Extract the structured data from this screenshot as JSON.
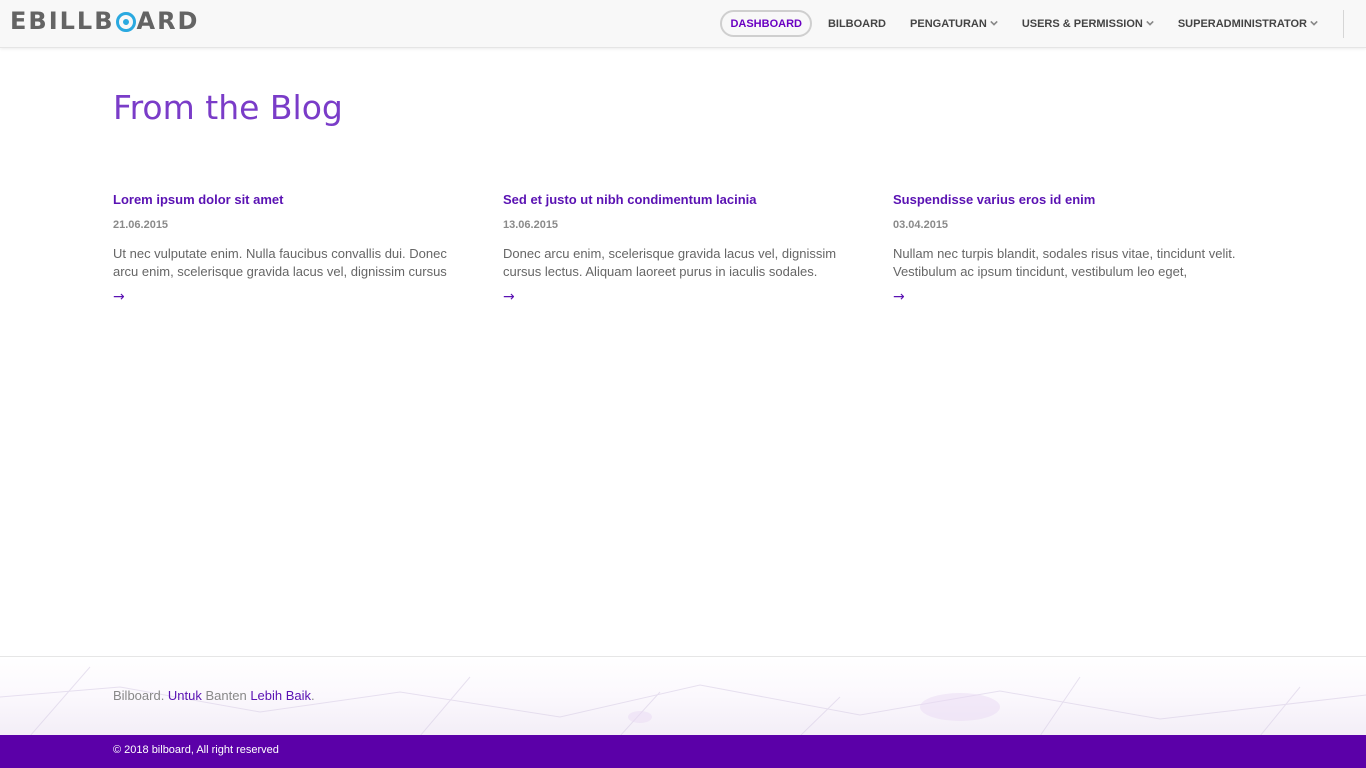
{
  "brand": {
    "logo_prefix": "EBILLB",
    "logo_suffix": "ARD",
    "accent": "#2aa9e0"
  },
  "nav": {
    "items": [
      {
        "label": "DASHBOARD",
        "active": true,
        "dropdown": false
      },
      {
        "label": "BILBOARD",
        "active": false,
        "dropdown": false
      },
      {
        "label": "PENGATURAN",
        "active": false,
        "dropdown": true
      },
      {
        "label": "USERS & PERMISSION",
        "active": false,
        "dropdown": true
      },
      {
        "label": "SUPERADMINISTRATOR",
        "active": false,
        "dropdown": true
      }
    ]
  },
  "blog": {
    "heading": "From the Blog",
    "posts": [
      {
        "title": "Lorem ipsum dolor sit amet",
        "date": "21.06.2015",
        "excerpt": "Ut nec vulputate enim. Nulla faucibus convallis dui. Donec arcu enim, scelerisque gravida lacus vel, dignissim cursus",
        "arrow": "→"
      },
      {
        "title": "Sed et justo ut nibh condimentum lacinia",
        "date": "13.06.2015",
        "excerpt": "Donec arcu enim, scelerisque gravida lacus vel, dignissim cursus lectus. Aliquam laoreet purus in iaculis sodales.",
        "arrow": "→"
      },
      {
        "title": "Suspendisse varius eros id enim",
        "date": "03.04.2015",
        "excerpt": "Nullam nec turpis blandit, sodales risus vitae, tincidunt velit. Vestibulum ac ipsum tincidunt, vestibulum leo eget,",
        "arrow": "→"
      }
    ]
  },
  "footer": {
    "tagline": {
      "part1": "Bilboard. ",
      "part2": "Untuk",
      "part3": " Banten ",
      "part4": "Lebih Baik",
      "part5": "."
    },
    "copyright": "© 2018 bilboard, All right reserved"
  },
  "colors": {
    "primary": "#5a12b3",
    "footer_bar": "#5b00a8",
    "heading": "#7a3cc8"
  }
}
